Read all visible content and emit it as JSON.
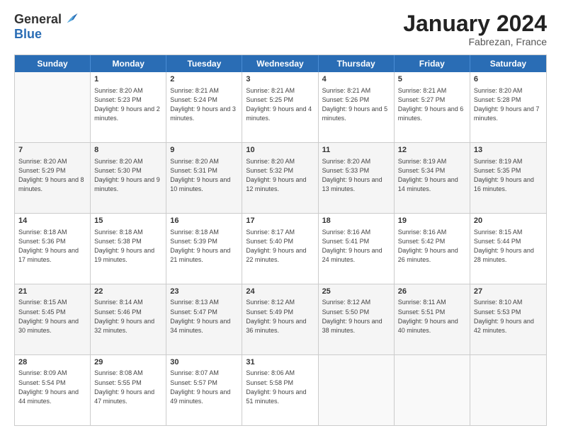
{
  "header": {
    "logo_general": "General",
    "logo_blue": "Blue",
    "month_title": "January 2024",
    "location": "Fabrezan, France"
  },
  "days_of_week": [
    "Sunday",
    "Monday",
    "Tuesday",
    "Wednesday",
    "Thursday",
    "Friday",
    "Saturday"
  ],
  "weeks": [
    [
      {
        "day": "",
        "sunrise": "",
        "sunset": "",
        "daylight": "",
        "empty": true
      },
      {
        "day": "1",
        "sunrise": "Sunrise: 8:20 AM",
        "sunset": "Sunset: 5:23 PM",
        "daylight": "Daylight: 9 hours and 2 minutes."
      },
      {
        "day": "2",
        "sunrise": "Sunrise: 8:21 AM",
        "sunset": "Sunset: 5:24 PM",
        "daylight": "Daylight: 9 hours and 3 minutes."
      },
      {
        "day": "3",
        "sunrise": "Sunrise: 8:21 AM",
        "sunset": "Sunset: 5:25 PM",
        "daylight": "Daylight: 9 hours and 4 minutes."
      },
      {
        "day": "4",
        "sunrise": "Sunrise: 8:21 AM",
        "sunset": "Sunset: 5:26 PM",
        "daylight": "Daylight: 9 hours and 5 minutes."
      },
      {
        "day": "5",
        "sunrise": "Sunrise: 8:21 AM",
        "sunset": "Sunset: 5:27 PM",
        "daylight": "Daylight: 9 hours and 6 minutes."
      },
      {
        "day": "6",
        "sunrise": "Sunrise: 8:20 AM",
        "sunset": "Sunset: 5:28 PM",
        "daylight": "Daylight: 9 hours and 7 minutes."
      }
    ],
    [
      {
        "day": "7",
        "sunrise": "Sunrise: 8:20 AM",
        "sunset": "Sunset: 5:29 PM",
        "daylight": "Daylight: 9 hours and 8 minutes."
      },
      {
        "day": "8",
        "sunrise": "Sunrise: 8:20 AM",
        "sunset": "Sunset: 5:30 PM",
        "daylight": "Daylight: 9 hours and 9 minutes."
      },
      {
        "day": "9",
        "sunrise": "Sunrise: 8:20 AM",
        "sunset": "Sunset: 5:31 PM",
        "daylight": "Daylight: 9 hours and 10 minutes."
      },
      {
        "day": "10",
        "sunrise": "Sunrise: 8:20 AM",
        "sunset": "Sunset: 5:32 PM",
        "daylight": "Daylight: 9 hours and 12 minutes."
      },
      {
        "day": "11",
        "sunrise": "Sunrise: 8:20 AM",
        "sunset": "Sunset: 5:33 PM",
        "daylight": "Daylight: 9 hours and 13 minutes."
      },
      {
        "day": "12",
        "sunrise": "Sunrise: 8:19 AM",
        "sunset": "Sunset: 5:34 PM",
        "daylight": "Daylight: 9 hours and 14 minutes."
      },
      {
        "day": "13",
        "sunrise": "Sunrise: 8:19 AM",
        "sunset": "Sunset: 5:35 PM",
        "daylight": "Daylight: 9 hours and 16 minutes."
      }
    ],
    [
      {
        "day": "14",
        "sunrise": "Sunrise: 8:18 AM",
        "sunset": "Sunset: 5:36 PM",
        "daylight": "Daylight: 9 hours and 17 minutes."
      },
      {
        "day": "15",
        "sunrise": "Sunrise: 8:18 AM",
        "sunset": "Sunset: 5:38 PM",
        "daylight": "Daylight: 9 hours and 19 minutes."
      },
      {
        "day": "16",
        "sunrise": "Sunrise: 8:18 AM",
        "sunset": "Sunset: 5:39 PM",
        "daylight": "Daylight: 9 hours and 21 minutes."
      },
      {
        "day": "17",
        "sunrise": "Sunrise: 8:17 AM",
        "sunset": "Sunset: 5:40 PM",
        "daylight": "Daylight: 9 hours and 22 minutes."
      },
      {
        "day": "18",
        "sunrise": "Sunrise: 8:16 AM",
        "sunset": "Sunset: 5:41 PM",
        "daylight": "Daylight: 9 hours and 24 minutes."
      },
      {
        "day": "19",
        "sunrise": "Sunrise: 8:16 AM",
        "sunset": "Sunset: 5:42 PM",
        "daylight": "Daylight: 9 hours and 26 minutes."
      },
      {
        "day": "20",
        "sunrise": "Sunrise: 8:15 AM",
        "sunset": "Sunset: 5:44 PM",
        "daylight": "Daylight: 9 hours and 28 minutes."
      }
    ],
    [
      {
        "day": "21",
        "sunrise": "Sunrise: 8:15 AM",
        "sunset": "Sunset: 5:45 PM",
        "daylight": "Daylight: 9 hours and 30 minutes."
      },
      {
        "day": "22",
        "sunrise": "Sunrise: 8:14 AM",
        "sunset": "Sunset: 5:46 PM",
        "daylight": "Daylight: 9 hours and 32 minutes."
      },
      {
        "day": "23",
        "sunrise": "Sunrise: 8:13 AM",
        "sunset": "Sunset: 5:47 PM",
        "daylight": "Daylight: 9 hours and 34 minutes."
      },
      {
        "day": "24",
        "sunrise": "Sunrise: 8:12 AM",
        "sunset": "Sunset: 5:49 PM",
        "daylight": "Daylight: 9 hours and 36 minutes."
      },
      {
        "day": "25",
        "sunrise": "Sunrise: 8:12 AM",
        "sunset": "Sunset: 5:50 PM",
        "daylight": "Daylight: 9 hours and 38 minutes."
      },
      {
        "day": "26",
        "sunrise": "Sunrise: 8:11 AM",
        "sunset": "Sunset: 5:51 PM",
        "daylight": "Daylight: 9 hours and 40 minutes."
      },
      {
        "day": "27",
        "sunrise": "Sunrise: 8:10 AM",
        "sunset": "Sunset: 5:53 PM",
        "daylight": "Daylight: 9 hours and 42 minutes."
      }
    ],
    [
      {
        "day": "28",
        "sunrise": "Sunrise: 8:09 AM",
        "sunset": "Sunset: 5:54 PM",
        "daylight": "Daylight: 9 hours and 44 minutes."
      },
      {
        "day": "29",
        "sunrise": "Sunrise: 8:08 AM",
        "sunset": "Sunset: 5:55 PM",
        "daylight": "Daylight: 9 hours and 47 minutes."
      },
      {
        "day": "30",
        "sunrise": "Sunrise: 8:07 AM",
        "sunset": "Sunset: 5:57 PM",
        "daylight": "Daylight: 9 hours and 49 minutes."
      },
      {
        "day": "31",
        "sunrise": "Sunrise: 8:06 AM",
        "sunset": "Sunset: 5:58 PM",
        "daylight": "Daylight: 9 hours and 51 minutes."
      },
      {
        "day": "",
        "sunrise": "",
        "sunset": "",
        "daylight": "",
        "empty": true
      },
      {
        "day": "",
        "sunrise": "",
        "sunset": "",
        "daylight": "",
        "empty": true
      },
      {
        "day": "",
        "sunrise": "",
        "sunset": "",
        "daylight": "",
        "empty": true
      }
    ]
  ]
}
